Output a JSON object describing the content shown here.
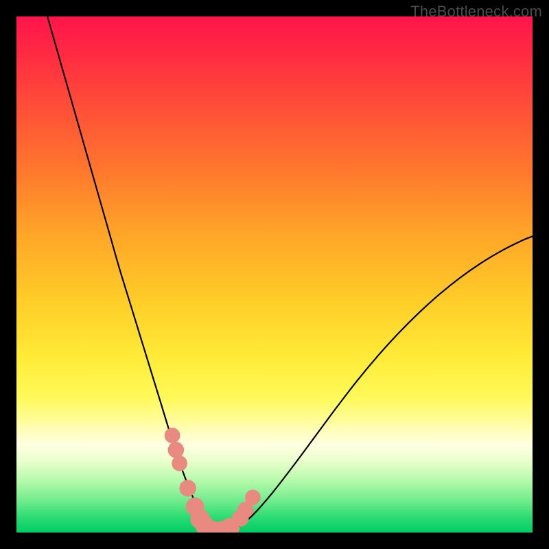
{
  "attribution": "TheBottleneck.com",
  "colors": {
    "frame_bg": "#000000",
    "curve": "#000000",
    "marker": "#e88a80"
  },
  "chart_data": {
    "type": "line",
    "title": "",
    "xlabel": "",
    "ylabel": "",
    "xlim": [
      0,
      100
    ],
    "ylim": [
      0,
      100
    ],
    "notes": "V-shaped bottleneck curve over vertical rainbow gradient; minimum near x≈36; axes have no numeric tick labels.",
    "series": [
      {
        "name": "bottleneck-curve",
        "x": [
          6,
          8,
          10,
          12,
          14,
          16,
          18,
          20,
          22,
          24,
          26,
          28,
          30,
          32,
          33,
          34,
          35,
          36,
          37,
          38,
          39,
          40,
          42,
          44,
          46,
          48,
          50,
          54,
          58,
          62,
          66,
          70,
          74,
          78,
          82,
          86,
          90,
          94,
          98,
          100
        ],
        "values": [
          100,
          93,
          86,
          79,
          72,
          65,
          58,
          51,
          44.5,
          38,
          31.5,
          25,
          18.5,
          12.5,
          9.8,
          7.3,
          5,
          3,
          1.5,
          0.6,
          0.2,
          0.2,
          0.6,
          1.8,
          3.6,
          5.8,
          8.2,
          13.4,
          18.8,
          24.2,
          29.4,
          34.2,
          38.6,
          42.6,
          46.2,
          49.4,
          52.2,
          54.6,
          56.6,
          57.4
        ]
      }
    ],
    "markers": [
      {
        "x": 30.2,
        "y": 18.8,
        "r": 1.4
      },
      {
        "x": 30.9,
        "y": 16.0,
        "r": 1.5
      },
      {
        "x": 31.6,
        "y": 13.4,
        "r": 1.4
      },
      {
        "x": 33.2,
        "y": 8.6,
        "r": 1.6
      },
      {
        "x": 34.6,
        "y": 5.0,
        "r": 1.9
      },
      {
        "x": 35.6,
        "y": 2.6,
        "r": 2.1
      },
      {
        "x": 36.6,
        "y": 1.2,
        "r": 2.1
      },
      {
        "x": 37.8,
        "y": 0.4,
        "r": 2.1
      },
      {
        "x": 39.0,
        "y": 0.2,
        "r": 2.1
      },
      {
        "x": 40.2,
        "y": 0.4,
        "r": 2.1
      },
      {
        "x": 41.4,
        "y": 1.0,
        "r": 2.0
      },
      {
        "x": 43.4,
        "y": 2.8,
        "r": 1.6
      },
      {
        "x": 44.4,
        "y": 4.4,
        "r": 1.5
      },
      {
        "x": 45.8,
        "y": 6.8,
        "r": 1.4
      }
    ]
  }
}
